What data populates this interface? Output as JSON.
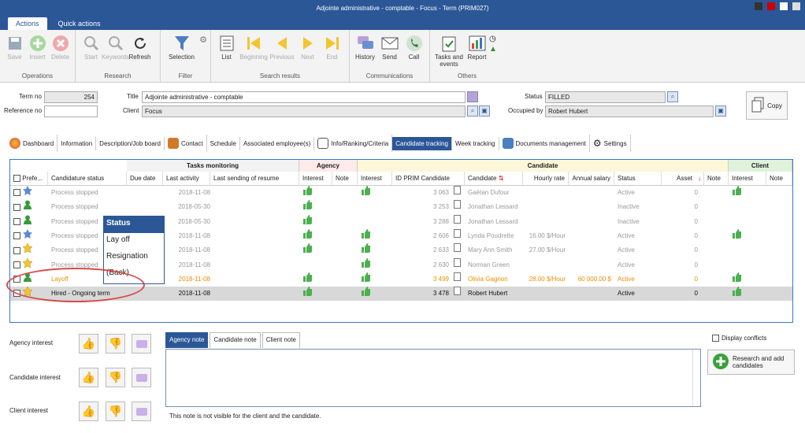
{
  "window": {
    "title": "Adjointe administrative - comptable - Focus - Term (PRIM027)"
  },
  "ribbon_tabs": [
    "Actions",
    "Quick actions"
  ],
  "ribbon": {
    "groups": [
      {
        "label": "Operations",
        "buttons": [
          "Save",
          "Insert",
          "Delete"
        ]
      },
      {
        "label": "Research",
        "buttons": [
          "Start",
          "Keywords",
          "Refresh"
        ]
      },
      {
        "label": "Filter",
        "buttons": [
          "Selection"
        ]
      },
      {
        "label": "Search results",
        "buttons": [
          "List",
          "Beginning",
          "Previous",
          "Next",
          "End"
        ]
      },
      {
        "label": "Communications",
        "buttons": [
          "History",
          "Send",
          "Call"
        ]
      },
      {
        "label": "Others",
        "buttons": [
          "Tasks and events",
          "Report"
        ]
      }
    ]
  },
  "form": {
    "term_no_label": "Term no",
    "term_no": "254",
    "reference_label": "Reference no",
    "reference": "",
    "title_label": "Title",
    "title": "Adjointe administrative - comptable",
    "client_label": "Client",
    "client": "Focus",
    "status_label": "Status",
    "status": "FILLED",
    "occupied_label": "Occupied by",
    "occupied": "Robert Hubert",
    "copy_label": "Copy"
  },
  "nav_tabs": [
    "Dashboard",
    "Information",
    "Description/Job board",
    "Contact",
    "Schedule",
    "Associated employee(s)",
    "Info/Ranking/Criteria",
    "Candidate tracking",
    "Week tracking",
    "Documents management",
    "Settings"
  ],
  "grid": {
    "groups": [
      "Tasks monitoring",
      "Agency",
      "Candidate",
      "Client"
    ],
    "columns": [
      "Prefe...",
      "Candidature status",
      "Due date",
      "Last activity",
      "Last sending of resume",
      "Interest",
      "Note",
      "Interest",
      "ID PRIM Candidate",
      "Candidate",
      "Hourly rate",
      "Annual salary",
      "Status",
      "Asset",
      "Note",
      "Interest",
      "Note"
    ],
    "rows": [
      {
        "pref": "star-blue",
        "status": "Process stopped",
        "last": "2018-11-08",
        "ag_int": true,
        "c_int": true,
        "id": "3 063",
        "name": "Gaëtan Dufour",
        "rate": "",
        "salary": "",
        "cstatus": "Active",
        "asset": "0",
        "cl_int": true,
        "style": "gray"
      },
      {
        "pref": "person-green",
        "status": "Process stopped",
        "last": "2018-05-30",
        "ag_int": true,
        "c_int": false,
        "id": "3 253",
        "name": "Jonathan Lessard",
        "rate": "",
        "salary": "",
        "cstatus": "Inactive",
        "asset": "0",
        "cl_int": false,
        "style": "gray"
      },
      {
        "pref": "person-green",
        "status": "Process stopped",
        "last": "2018-05-30",
        "ag_int": true,
        "c_int": false,
        "id": "3 288",
        "name": "Jonathan Lessard",
        "rate": "",
        "salary": "",
        "cstatus": "Inactive",
        "asset": "0",
        "cl_int": false,
        "style": "gray"
      },
      {
        "pref": "star-blue",
        "status": "Process stopped",
        "last": "2018-11-08",
        "ag_int": true,
        "c_int": true,
        "id": "2 606",
        "name": "Lynda Poudrette",
        "rate": "16.00 $/Hour",
        "salary": "",
        "cstatus": "Active",
        "asset": "0",
        "cl_int": true,
        "style": "gray"
      },
      {
        "pref": "star-yellow",
        "status": "Process stopped",
        "last": "2018-11-08",
        "ag_int": true,
        "c_int": true,
        "id": "2 633",
        "name": "Mary Ann Smith",
        "rate": "27.00 $/Hour",
        "salary": "",
        "cstatus": "Active",
        "asset": "0",
        "cl_int": false,
        "style": "gray"
      },
      {
        "pref": "star-yellow",
        "status": "Process stopped",
        "last": "2018-11-08",
        "ag_int": false,
        "c_int": true,
        "id": "2 630",
        "name": "Norman Green",
        "rate": "",
        "salary": "",
        "cstatus": "Active",
        "asset": "0",
        "cl_int": false,
        "style": "gray"
      },
      {
        "pref": "person-green",
        "status": "Layoff",
        "last": "2018-11-08",
        "ag_int": true,
        "c_int": true,
        "id": "3 499",
        "name": "Olivia Gagnon",
        "rate": "28.00 $/Hour",
        "salary": "60 000.00 $",
        "cstatus": "Active",
        "asset": "0",
        "cl_int": true,
        "style": "orange"
      },
      {
        "pref": "star-yellow",
        "status": "Hired - Ongoing term",
        "last": "2018-11-08",
        "ag_int": true,
        "c_int": true,
        "id": "3 478",
        "name": "Robert Hubert",
        "rate": "",
        "salary": "",
        "cstatus": "Active",
        "asset": "0",
        "cl_int": true,
        "style": "selected"
      }
    ]
  },
  "status_popup": {
    "header": "Status",
    "options": [
      "Lay off",
      "Resignation",
      "(Back)"
    ]
  },
  "lower": {
    "agency_interest": "Agency interest",
    "candidate_interest": "Candidate interest",
    "client_interest": "Client interest",
    "note_tabs": [
      "Agency note",
      "Candidate note",
      "Client note"
    ],
    "note_footer": "This note is not visible for the client and the candidate.",
    "display_conflicts": "Display conflicts",
    "research_btn": "Research and add candidates"
  }
}
